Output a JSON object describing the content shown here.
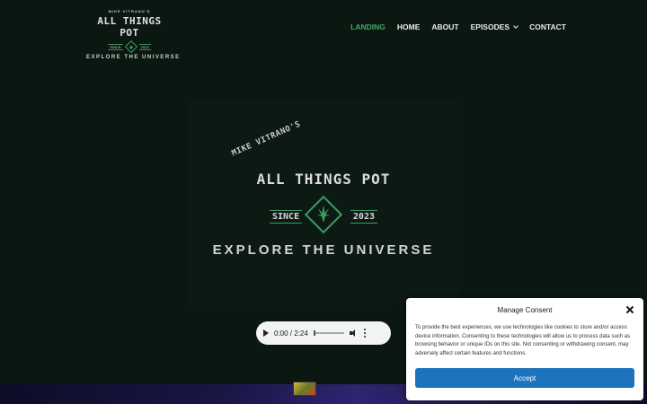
{
  "logo": {
    "top_text": "MIKE VITRANO'S",
    "title": "ALL THINGS POT",
    "since": "SINCE",
    "year": "2023",
    "tagline": "EXPLORE THE UNIVERSE"
  },
  "nav": {
    "items": [
      {
        "label": "LANDING",
        "active": true
      },
      {
        "label": "HOME",
        "active": false
      },
      {
        "label": "ABOUT",
        "active": false
      },
      {
        "label": "EPISODES",
        "active": false,
        "has_dropdown": true
      },
      {
        "label": "CONTACT",
        "active": false
      }
    ]
  },
  "hero": {
    "arc_text": "MIKE VITRANO'S",
    "title": "ALL THINGS POT",
    "since": "SINCE",
    "year": "2023",
    "tagline": "EXPLORE THE UNIVERSE"
  },
  "audio": {
    "time": "0:00 / 2:24",
    "icons": [
      "play-icon",
      "volume-icon",
      "more-options-icon"
    ]
  },
  "consent": {
    "title": "Manage Consent",
    "text": "To provide the best experiences, we use technologies like cookies to store and/or access device information. Consenting to these technologies will allow us to process data such as browsing behavior or unique IDs on this site. Not consenting or withdrawing consent, may adversely affect certain features and functions.",
    "accept_label": "Accept"
  },
  "colors": {
    "background": "#0b1711",
    "accent_green": "#3fa868",
    "accept_blue": "#1e73be"
  }
}
